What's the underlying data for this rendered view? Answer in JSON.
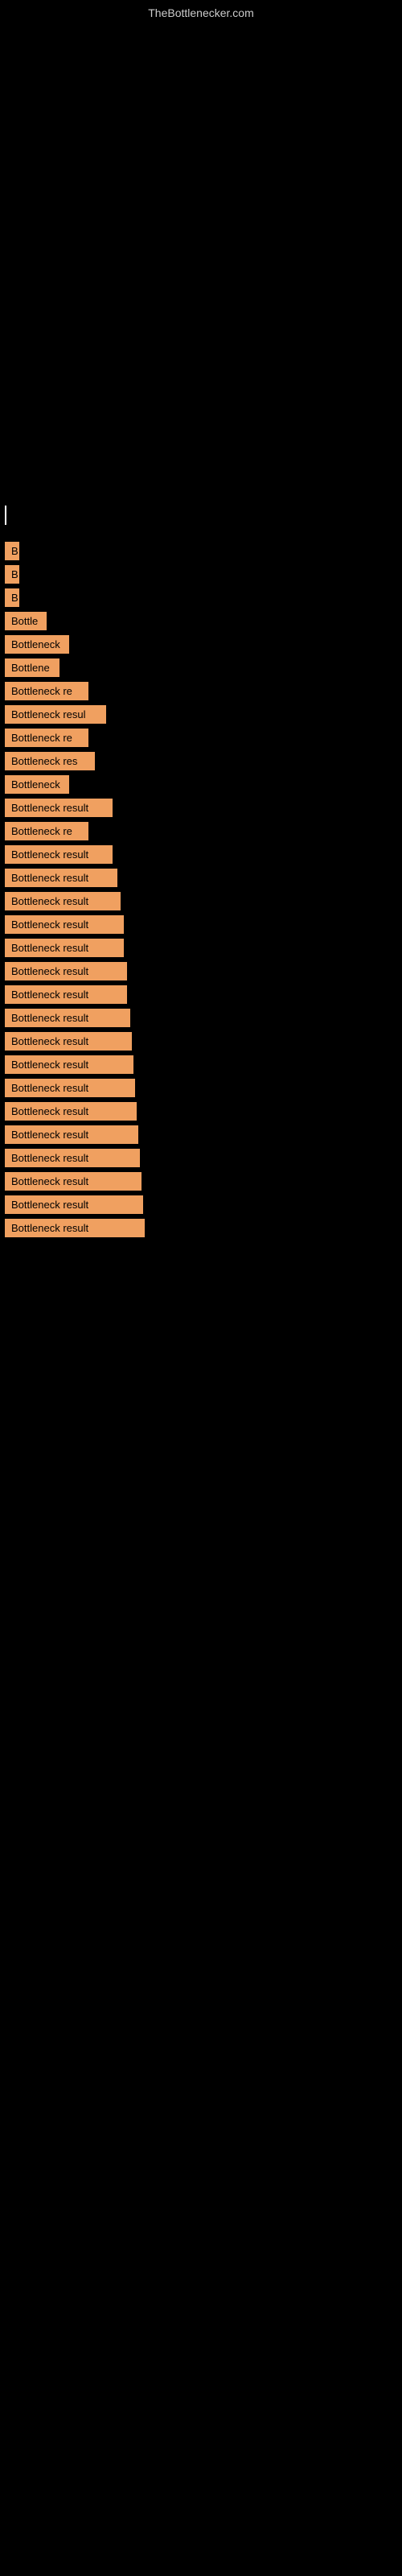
{
  "site": {
    "title": "TheBottlenecker.com"
  },
  "results": [
    {
      "id": 1,
      "label": "B",
      "width": 18
    },
    {
      "id": 2,
      "label": "B",
      "width": 18
    },
    {
      "id": 3,
      "label": "B",
      "width": 18
    },
    {
      "id": 4,
      "label": "Bottle",
      "width": 52
    },
    {
      "id": 5,
      "label": "Bottleneck",
      "width": 80
    },
    {
      "id": 6,
      "label": "Bottlene",
      "width": 68
    },
    {
      "id": 7,
      "label": "Bottleneck re",
      "width": 104
    },
    {
      "id": 8,
      "label": "Bottleneck resul",
      "width": 126
    },
    {
      "id": 9,
      "label": "Bottleneck re",
      "width": 104
    },
    {
      "id": 10,
      "label": "Bottleneck res",
      "width": 112
    },
    {
      "id": 11,
      "label": "Bottleneck",
      "width": 80
    },
    {
      "id": 12,
      "label": "Bottleneck result",
      "width": 134
    },
    {
      "id": 13,
      "label": "Bottleneck re",
      "width": 104
    },
    {
      "id": 14,
      "label": "Bottleneck result",
      "width": 134
    },
    {
      "id": 15,
      "label": "Bottleneck result",
      "width": 140
    },
    {
      "id": 16,
      "label": "Bottleneck result",
      "width": 144
    },
    {
      "id": 17,
      "label": "Bottleneck result",
      "width": 148
    },
    {
      "id": 18,
      "label": "Bottleneck result",
      "width": 148
    },
    {
      "id": 19,
      "label": "Bottleneck result",
      "width": 152
    },
    {
      "id": 20,
      "label": "Bottleneck result",
      "width": 152
    },
    {
      "id": 21,
      "label": "Bottleneck result",
      "width": 156
    },
    {
      "id": 22,
      "label": "Bottleneck result",
      "width": 158
    },
    {
      "id": 23,
      "label": "Bottleneck result",
      "width": 160
    },
    {
      "id": 24,
      "label": "Bottleneck result",
      "width": 162
    },
    {
      "id": 25,
      "label": "Bottleneck result",
      "width": 164
    },
    {
      "id": 26,
      "label": "Bottleneck result",
      "width": 166
    },
    {
      "id": 27,
      "label": "Bottleneck result",
      "width": 168
    },
    {
      "id": 28,
      "label": "Bottleneck result",
      "width": 170
    },
    {
      "id": 29,
      "label": "Bottleneck result",
      "width": 172
    },
    {
      "id": 30,
      "label": "Bottleneck result",
      "width": 174
    }
  ]
}
